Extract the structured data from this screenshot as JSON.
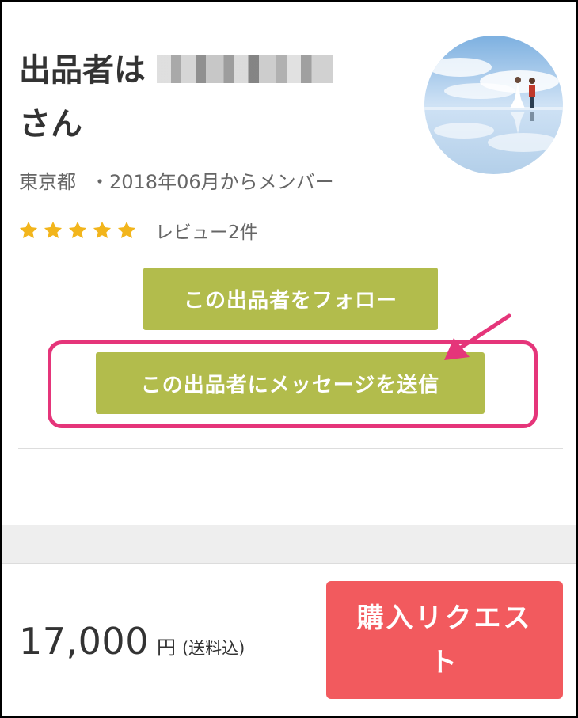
{
  "seller": {
    "title_prefix": "出品者は",
    "title_suffix": "さん",
    "location": "東京都",
    "member_since": "・2018年06月からメンバー",
    "rating_stars": 5,
    "reviews_label": "レビュー2件"
  },
  "actions": {
    "follow_label": "この出品者をフォロー",
    "message_label": "この出品者にメッセージを送信"
  },
  "purchase": {
    "price": "17,000",
    "currency": "円",
    "shipping_note": "(送料込)",
    "request_label": "購入リクエスト"
  },
  "colors": {
    "olive_button": "#b2bc4c",
    "purchase_button": "#f25a5e",
    "highlight": "#e5357a",
    "star": "#f2b51c"
  },
  "icons": {
    "star": "star-icon",
    "annotation_arrow": "arrow-icon"
  }
}
